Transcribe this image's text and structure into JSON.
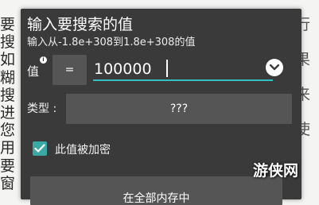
{
  "background": {
    "left_chars": [
      "要",
      "搜",
      "如",
      "糊",
      "搜",
      "进",
      "您",
      "用",
      "要",
      "窗"
    ],
    "right_chars": [
      "行",
      "",
      "果",
      "",
      "来",
      "",
      "使",
      "",
      ""
    ]
  },
  "dialog": {
    "title": "输入要搜索的值",
    "subtitle": "输入从-1.8e+308到1.8e+308的值",
    "value_label": "值",
    "info_icon": "i",
    "operator": "=",
    "value_input": "100000",
    "type_label": "类型 :",
    "type_value": "???",
    "checkbox_checked": true,
    "checkbox_label": "此值被加密",
    "range_button": "在全部内存中"
  },
  "watermark": "游侠网",
  "colors": {
    "dialog_bg": "#3a3a3a",
    "button_bg": "#555555",
    "accent": "#32bfbf",
    "checkbox": "#39a9a3"
  }
}
